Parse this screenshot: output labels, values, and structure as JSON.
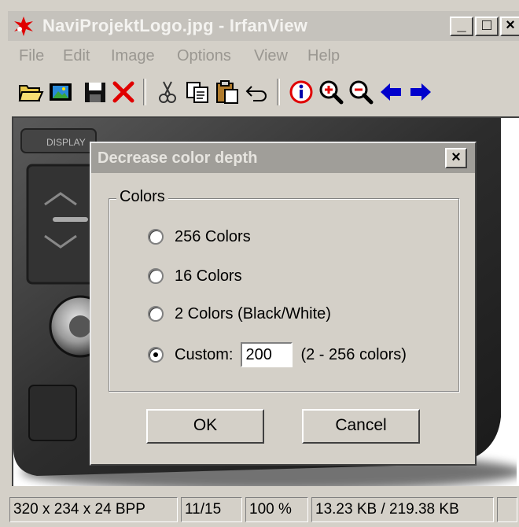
{
  "window": {
    "title": "NaviProjektLogo.jpg - IrfanView",
    "controls": {
      "minimize": "_",
      "maximize": "□",
      "close": "×"
    }
  },
  "menu": {
    "items": [
      {
        "label": "File"
      },
      {
        "label": "Edit"
      },
      {
        "label": "Image"
      },
      {
        "label": "Options"
      },
      {
        "label": "View"
      },
      {
        "label": "Help"
      }
    ]
  },
  "toolbar": {
    "buttons": [
      {
        "icon": "open-folder-icon"
      },
      {
        "icon": "slideshow-icon"
      },
      {
        "icon": "save-icon"
      },
      {
        "icon": "delete-icon"
      },
      {
        "icon": "cut-icon"
      },
      {
        "icon": "copy-icon"
      },
      {
        "icon": "paste-icon"
      },
      {
        "icon": "undo-icon"
      },
      {
        "icon": "info-icon"
      },
      {
        "icon": "zoom-in-icon"
      },
      {
        "icon": "zoom-out-icon"
      },
      {
        "icon": "previous-arrow-icon"
      },
      {
        "icon": "next-arrow-icon"
      }
    ]
  },
  "dialog": {
    "title": "Decrease color depth",
    "close": "×",
    "group_label": "Colors",
    "options": [
      {
        "label": "256 Colors",
        "selected": false
      },
      {
        "label": "16 Colors",
        "selected": false
      },
      {
        "label": "2 Colors (Black/White)",
        "selected": false
      },
      {
        "label": "Custom:",
        "selected": true
      }
    ],
    "custom_value": "200",
    "custom_hint": "(2 - 256 colors)",
    "ok_label": "OK",
    "cancel_label": "Cancel"
  },
  "status": {
    "dimensions": "320 x 234 x 24 BPP",
    "index": "11/15",
    "zoom": "100 %",
    "size": "13.23 KB / 219.38 KB"
  },
  "colors": {
    "titlebar_inactive": "#c5c2bc",
    "face": "#d4d0c8",
    "red_icon": "#e00000",
    "blue_icon": "#0000cc"
  }
}
